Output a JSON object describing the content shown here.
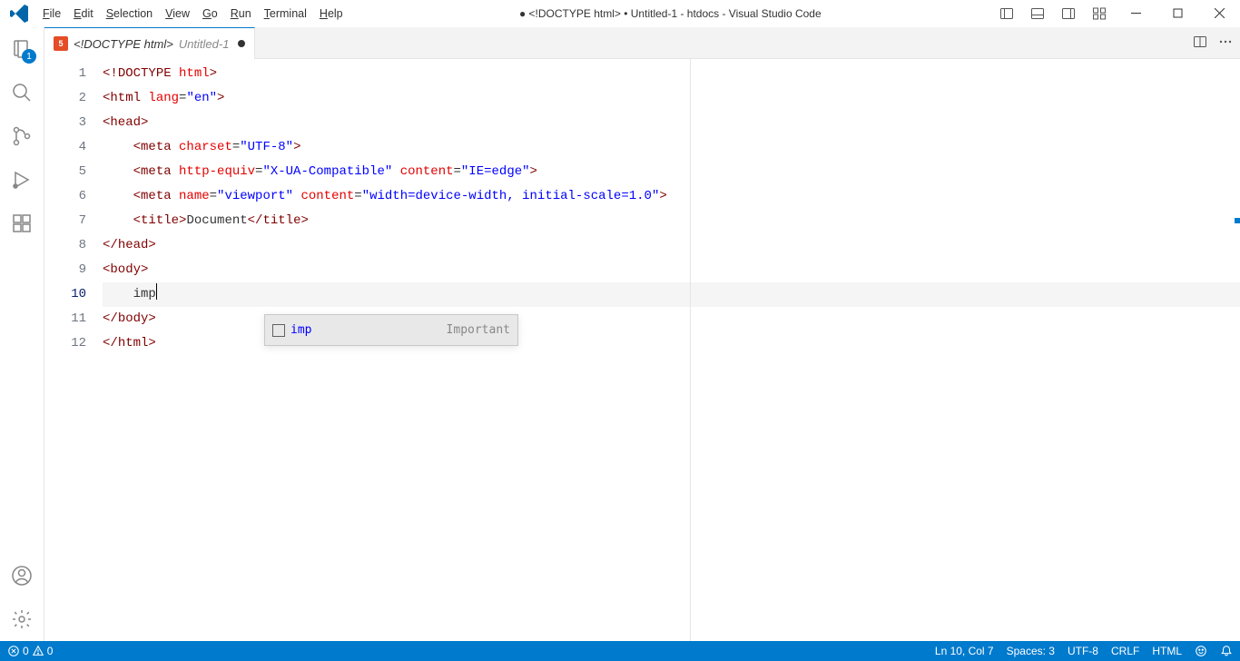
{
  "title": "● <!DOCTYPE html> • Untitled-1 - htdocs - Visual Studio Code",
  "menu": {
    "file": "File",
    "edit": "Edit",
    "selection": "Selection",
    "view": "View",
    "go": "Go",
    "run": "Run",
    "terminal": "Terminal",
    "help": "Help"
  },
  "activity": {
    "explorer_badge": "1"
  },
  "tab": {
    "label_primary": "<!DOCTYPE html>",
    "label_secondary": "Untitled-1"
  },
  "code": {
    "lines": [
      {
        "n": "1"
      },
      {
        "n": "2"
      },
      {
        "n": "3"
      },
      {
        "n": "4"
      },
      {
        "n": "5"
      },
      {
        "n": "6"
      },
      {
        "n": "7"
      },
      {
        "n": "8"
      },
      {
        "n": "9"
      },
      {
        "n": "10"
      },
      {
        "n": "11"
      },
      {
        "n": "12"
      }
    ],
    "l1_a": "<!",
    "l1_b": "DOCTYPE",
    "l1_c": " ",
    "l1_d": "html",
    "l1_e": ">",
    "l2_a": "<",
    "l2_b": "html",
    "l2_c": " ",
    "l2_d": "lang",
    "l2_e": "=",
    "l2_f": "\"en\"",
    "l2_g": ">",
    "l3_a": "<",
    "l3_b": "head",
    "l3_c": ">",
    "l4_a": "    <",
    "l4_b": "meta",
    "l4_c": " ",
    "l4_d": "charset",
    "l4_e": "=",
    "l4_f": "\"UTF-8\"",
    "l4_g": ">",
    "l5_a": "    <",
    "l5_b": "meta",
    "l5_c": " ",
    "l5_d": "http-equiv",
    "l5_e": "=",
    "l5_f": "\"X-UA-Compatible\"",
    "l5_g": " ",
    "l5_h": "content",
    "l5_i": "=",
    "l5_j": "\"IE=edge\"",
    "l5_k": ">",
    "l6_a": "    <",
    "l6_b": "meta",
    "l6_c": " ",
    "l6_d": "name",
    "l6_e": "=",
    "l6_f": "\"viewport\"",
    "l6_g": " ",
    "l6_h": "content",
    "l6_i": "=",
    "l6_j": "\"width=device-width, initial-scale=1.0\"",
    "l6_k": ">",
    "l7_a": "    <",
    "l7_b": "title",
    "l7_c": ">",
    "l7_d": "Document",
    "l7_e": "</",
    "l7_f": "title",
    "l7_g": ">",
    "l8_a": "</",
    "l8_b": "head",
    "l8_c": ">",
    "l9_a": "<",
    "l9_b": "body",
    "l9_c": ">",
    "l10_a": "    imp",
    "l11_a": "</",
    "l11_b": "body",
    "l11_c": ">",
    "l12_a": "</",
    "l12_b": "html",
    "l12_c": ">"
  },
  "suggest": {
    "label": "imp",
    "desc": "Important"
  },
  "status": {
    "errors": "0",
    "warnings": "0",
    "ln_col": "Ln 10, Col 7",
    "spaces": "Spaces: 3",
    "encoding": "UTF-8",
    "eol": "CRLF",
    "language": "HTML"
  }
}
